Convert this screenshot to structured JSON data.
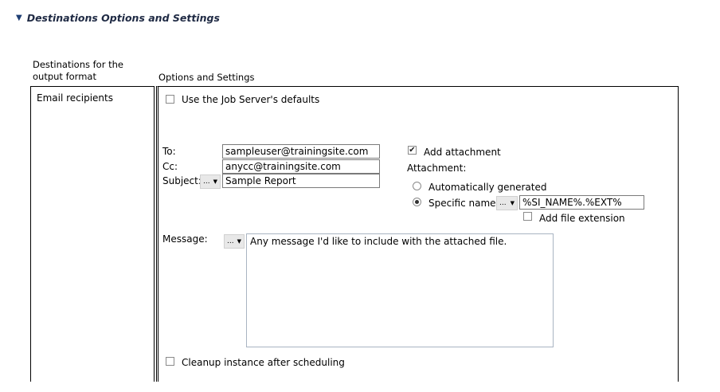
{
  "section": {
    "title": "Destinations Options and Settings"
  },
  "columns": {
    "destinations_header": "Destinations for the output format",
    "options_header": "Options and Settings"
  },
  "destination": {
    "label": "Email recipients"
  },
  "job_server_defaults": {
    "label": "Use the Job Server's defaults",
    "checked": false
  },
  "to": {
    "label": "To:",
    "value": "sampleuser@trainingsite.com"
  },
  "cc": {
    "label": "Cc:",
    "value": "anycc@trainingsite.com"
  },
  "subject": {
    "label": "Subject:",
    "value": "Sample Report",
    "dropdown": "..."
  },
  "attachment": {
    "add_label": "Add attachment",
    "add_checked": true,
    "heading": "Attachment:",
    "auto_label": "Automatically generated",
    "specific_label": "Specific name:",
    "specific_dropdown": "...",
    "specific_value": "%SI_NAME%.%EXT%",
    "add_ext_label": "Add file extension",
    "add_ext_checked": false,
    "selected": "specific"
  },
  "message": {
    "label": "Message:",
    "dropdown": "...",
    "value": "Any message I'd like to include with the attached file."
  },
  "cleanup": {
    "label": "Cleanup instance after scheduling",
    "checked": false
  }
}
